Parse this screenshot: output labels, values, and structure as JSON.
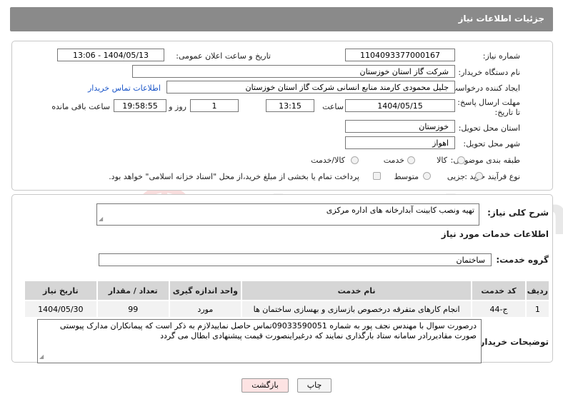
{
  "header": {
    "title": "جزئیات اطلاعات نیاز"
  },
  "fields": {
    "need_number_label": "شماره نیاز:",
    "need_number": "1104093377000167",
    "announce_label": "تاریخ و ساعت اعلان عمومی:",
    "announce_value": "1404/05/13 - 13:06",
    "buyer_org_label": "نام دستگاه خریدار:",
    "buyer_org": "شرکت گاز استان خوزستان",
    "creator_label": "ایجاد کننده درخواست:",
    "creator": "جلیل محمودی کارمند منابع انسانی شرکت گاز استان خوزستان",
    "contact_link": "اطلاعات تماس خریدار",
    "deadline_label": "مهلت ارسال پاسخ: تا تاریخ:",
    "deadline_date": "1404/05/15",
    "hour_label": "ساعت",
    "deadline_time": "13:15",
    "days_value": "1",
    "days_label": "روز و",
    "remaining_value": "19:58:55",
    "remaining_label": "ساعت باقی مانده",
    "province_label": "استان محل تحویل:",
    "province": "خوزستان",
    "city_label": "شهر محل تحویل:",
    "city": "اهواز",
    "category_label": "طبقه بندی موضوعی:",
    "category_options": [
      "کالا",
      "خدمت",
      "کالا/خدمت"
    ],
    "process_label": "نوع فرآیند خرید :",
    "process_options": [
      "جزیی",
      "متوسط"
    ],
    "payment_note": "پرداخت تمام یا بخشی از مبلغ خرید،از محل \"اسناد خزانه اسلامی\" خواهد بود."
  },
  "summary": {
    "label": "شرح کلی نیاز:",
    "value": "تهیه ونصب کابینت آبدارخانه های اداره مرکزی"
  },
  "services": {
    "section_title": "اطلاعات خدمات مورد نیاز",
    "group_label": "گروه خدمت:",
    "group_value": "ساختمان",
    "columns": [
      "ردیف",
      "کد خدمت",
      "نام خدمت",
      "واحد اندازه گیری",
      "تعداد / مقدار",
      "تاریخ نیاز"
    ],
    "rows": [
      {
        "row": "1",
        "code": "ج-44",
        "name": "انجام کارهای متفرقه درخصوص بازسازی و بهسازی ساختمان ها",
        "unit": "مورد",
        "qty": "99",
        "date": "1404/05/30"
      }
    ]
  },
  "buyer_notes": {
    "label": "توضیحات خریدار:",
    "value": "درصورت سوال با مهندس نجف پور به شماره 09033590051تماس حاصل نماییدلازم به ذکر است که پیمانکاران مدارک پیوستی صورت مقادیررادر سامانه ستاد بارگذاری نمایند که درغیراینصورت قیمت پیشنهادی ابطال می گردد"
  },
  "buttons": {
    "print": "چاپ",
    "back": "بازگشت"
  },
  "watermark": {
    "text": "AriaTender.neT"
  },
  "colors": {
    "header_bg": "#8a8a8a",
    "link": "#1a55c8",
    "table_header": "#d6d6d6",
    "back_button": "#fde3e3"
  }
}
